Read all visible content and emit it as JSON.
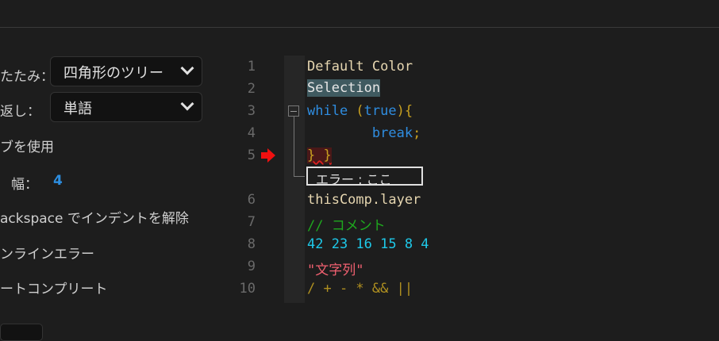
{
  "settings": {
    "folding_label": "たたみ：",
    "folding_value": "四角形のツリー",
    "wrap_label": "返し：",
    "wrap_value": "単語",
    "use_tabs": "ブを使用",
    "tab_width_label": "幅：",
    "tab_width_value": "4",
    "backspace_unindent": "ackspace でインデントを解除",
    "inline_errors": "ンラインエラー",
    "autocomplete": "ートコンプリート"
  },
  "preview": {
    "line_numbers": [
      "1",
      "2",
      "3",
      "4",
      "5",
      "6",
      "7",
      "8",
      "9",
      "10"
    ],
    "lines": {
      "default": "Default Color",
      "selection": "Selection",
      "while_kw": "while",
      "paren_open": " (",
      "true_kw": "true",
      "paren_close": "){",
      "break_kw": "        break",
      "semicolon": ";",
      "braces": "} }",
      "error": "エラー : ここ",
      "this_comp": "thisComp.layer",
      "comment": "// コメント",
      "numbers": "42 23 16 15 8 4",
      "string": "\"文字列\"",
      "operators": "/ + - * && ||"
    },
    "colors": {
      "default": "#e6d6b0",
      "keyword": "#2f8de0",
      "number": "#1ec8e8",
      "comment": "#1ea81e",
      "string": "#f06070",
      "operator": "#b09020",
      "bracket": "#c8a020",
      "error_bg": "#4a1818"
    }
  }
}
